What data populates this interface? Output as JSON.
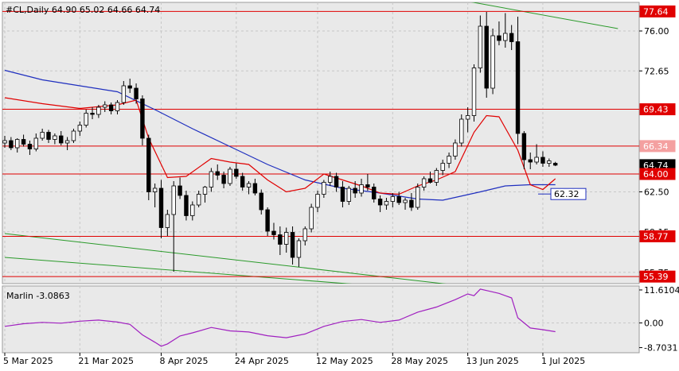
{
  "header": {
    "symbol_line": "#CL,Daily  64.90 65.02 64.66 64.74"
  },
  "colors": {
    "background": "#e9e9e9",
    "grid": "#c8c8c8",
    "support_resistance": "#e00000",
    "bollinger": "#e00000",
    "moving_average": "#1f2fbf",
    "channel": "#2a9a2a",
    "oscillator": "#a020c0",
    "candle_bull": "#ffffff",
    "candle_bear": "#000000"
  },
  "chart_data": [
    {
      "type": "candlestick",
      "title": "#CL,Daily",
      "ohlc_last": {
        "open": 64.9,
        "high": 65.02,
        "low": 64.66,
        "close": 64.74
      },
      "ylim": [
        54.8,
        78.4
      ],
      "y_ticks": [
        "76.00",
        "72.65",
        "62.50",
        "59.15",
        "55.75"
      ],
      "x_ticks": [
        "5 Mar 2025",
        "21 Mar 2025",
        "8 Apr 2025",
        "24 Apr 2025",
        "12 May 2025",
        "28 May 2025",
        "13 Jun 2025",
        "1 Jul 2025"
      ],
      "x_tick_index": [
        0,
        12,
        25,
        37,
        50,
        62,
        74,
        86
      ],
      "price_levels": [
        {
          "value": 77.64,
          "label": "77.64",
          "style": "red-box"
        },
        {
          "value": 69.43,
          "label": "69.43",
          "style": "red-box"
        },
        {
          "value": 66.34,
          "label": "66.34",
          "style": "light-red-box"
        },
        {
          "value": 64.74,
          "label": "64.74",
          "style": "black-box"
        },
        {
          "value": 64.0,
          "label": "64.00",
          "style": "red-box"
        },
        {
          "value": 62.32,
          "label": "62.32",
          "style": "blue-box"
        },
        {
          "value": 58.77,
          "label": "58.77",
          "style": "red-box"
        },
        {
          "value": 55.39,
          "label": "55.39",
          "style": "red-box"
        }
      ],
      "horizontal_lines": [
        77.64,
        69.43,
        66.34,
        64.0,
        58.77,
        55.39
      ],
      "candles": [
        [
          66.6,
          67.2,
          66.2,
          66.8
        ],
        [
          66.8,
          67.1,
          66.0,
          66.2
        ],
        [
          66.2,
          67.0,
          65.8,
          66.9
        ],
        [
          66.9,
          67.3,
          66.3,
          66.5
        ],
        [
          66.5,
          66.8,
          65.6,
          66.1
        ],
        [
          66.1,
          67.4,
          65.9,
          67.0
        ],
        [
          67.0,
          67.8,
          66.8,
          67.5
        ],
        [
          67.5,
          67.7,
          66.6,
          66.9
        ],
        [
          66.9,
          67.4,
          66.5,
          67.2
        ],
        [
          67.2,
          67.6,
          66.4,
          66.6
        ],
        [
          66.6,
          67.1,
          66.0,
          66.8
        ],
        [
          66.8,
          67.8,
          66.6,
          67.6
        ],
        [
          67.6,
          68.4,
          67.2,
          68.1
        ],
        [
          68.1,
          69.4,
          67.9,
          69.1
        ],
        [
          69.1,
          69.6,
          68.6,
          69.0
        ],
        [
          69.0,
          69.8,
          68.7,
          69.6
        ],
        [
          69.6,
          70.1,
          69.2,
          69.8
        ],
        [
          69.8,
          70.0,
          69.0,
          69.3
        ],
        [
          69.3,
          70.2,
          69.0,
          70.0
        ],
        [
          70.0,
          71.8,
          69.8,
          71.4
        ],
        [
          71.4,
          72.0,
          70.8,
          71.2
        ],
        [
          71.2,
          71.6,
          69.9,
          70.3
        ],
        [
          70.3,
          70.6,
          66.4,
          67.0
        ],
        [
          67.0,
          67.3,
          61.8,
          62.5
        ],
        [
          62.5,
          63.2,
          61.2,
          62.8
        ],
        [
          62.8,
          63.5,
          58.6,
          59.5
        ],
        [
          59.5,
          61.0,
          58.8,
          60.6
        ],
        [
          60.6,
          63.4,
          55.8,
          63.0
        ],
        [
          63.0,
          63.7,
          61.9,
          62.2
        ],
        [
          62.2,
          62.6,
          60.1,
          60.5
        ],
        [
          60.5,
          61.7,
          60.1,
          61.4
        ],
        [
          61.4,
          62.6,
          61.2,
          62.3
        ],
        [
          62.3,
          63.0,
          61.6,
          62.9
        ],
        [
          62.9,
          64.5,
          62.5,
          64.2
        ],
        [
          64.2,
          64.8,
          63.5,
          63.9
        ],
        [
          63.9,
          64.2,
          62.8,
          63.2
        ],
        [
          63.2,
          64.6,
          63.0,
          64.4
        ],
        [
          64.4,
          64.9,
          63.6,
          63.8
        ],
        [
          63.8,
          64.1,
          62.6,
          62.9
        ],
        [
          62.9,
          63.4,
          62.3,
          63.2
        ],
        [
          63.2,
          63.6,
          62.2,
          62.4
        ],
        [
          62.4,
          62.7,
          60.6,
          61.0
        ],
        [
          61.0,
          61.2,
          58.8,
          59.2
        ],
        [
          59.2,
          59.9,
          58.5,
          58.9
        ],
        [
          58.9,
          59.6,
          57.2,
          58.1
        ],
        [
          58.1,
          59.5,
          57.4,
          59.1
        ],
        [
          59.1,
          59.6,
          56.4,
          57.0
        ],
        [
          57.0,
          58.6,
          56.2,
          58.4
        ],
        [
          58.4,
          59.6,
          58.0,
          59.4
        ],
        [
          59.4,
          61.5,
          59.1,
          61.2
        ],
        [
          61.2,
          62.6,
          60.8,
          62.3
        ],
        [
          62.3,
          63.5,
          62.0,
          63.3
        ],
        [
          63.3,
          64.2,
          63.0,
          63.8
        ],
        [
          63.8,
          64.1,
          62.5,
          62.9
        ],
        [
          62.9,
          63.4,
          61.2,
          61.7
        ],
        [
          61.7,
          63.0,
          61.4,
          62.8
        ],
        [
          62.8,
          63.4,
          62.0,
          62.4
        ],
        [
          62.4,
          63.6,
          62.1,
          63.1
        ],
        [
          63.1,
          64.0,
          62.6,
          62.9
        ],
        [
          62.9,
          63.2,
          61.6,
          61.9
        ],
        [
          61.9,
          62.2,
          60.8,
          61.4
        ],
        [
          61.4,
          62.0,
          61.0,
          61.7
        ],
        [
          61.7,
          62.4,
          61.2,
          62.1
        ],
        [
          62.1,
          62.5,
          61.4,
          61.6
        ],
        [
          61.6,
          62.0,
          61.0,
          61.8
        ],
        [
          61.8,
          62.4,
          60.9,
          61.2
        ],
        [
          61.2,
          63.2,
          61.0,
          62.9
        ],
        [
          62.9,
          63.8,
          62.6,
          63.6
        ],
        [
          63.6,
          64.2,
          63.2,
          63.3
        ],
        [
          63.3,
          64.5,
          63.0,
          64.3
        ],
        [
          64.3,
          65.2,
          63.9,
          64.9
        ],
        [
          64.9,
          65.8,
          64.5,
          65.5
        ],
        [
          65.5,
          66.9,
          65.2,
          66.6
        ],
        [
          66.6,
          69.0,
          66.3,
          68.6
        ],
        [
          68.6,
          69.6,
          67.5,
          68.9
        ],
        [
          68.9,
          73.2,
          68.4,
          72.9
        ],
        [
          72.9,
          77.3,
          72.5,
          76.4
        ],
        [
          76.4,
          77.6,
          70.4,
          71.2
        ],
        [
          71.2,
          76.2,
          70.7,
          75.6
        ],
        [
          75.6,
          76.8,
          74.8,
          75.2
        ],
        [
          75.2,
          77.5,
          74.6,
          75.8
        ],
        [
          75.8,
          76.5,
          74.4,
          75.1
        ],
        [
          75.1,
          77.2,
          66.5,
          67.4
        ],
        [
          67.4,
          67.6,
          64.4,
          65.2
        ],
        [
          65.2,
          65.8,
          64.4,
          65.0
        ],
        [
          65.0,
          66.5,
          64.8,
          65.4
        ],
        [
          65.4,
          65.9,
          64.6,
          64.9
        ],
        [
          64.9,
          65.3,
          64.6,
          65.1
        ],
        [
          64.9,
          65.02,
          64.66,
          64.74
        ]
      ],
      "moving_average": {
        "name": "",
        "x": [
          0,
          6,
          12,
          18,
          24,
          30,
          36,
          42,
          48,
          54,
          60,
          66,
          70,
          76,
          80,
          84,
          88
        ],
        "y": [
          72.7,
          71.9,
          71.4,
          70.9,
          69.4,
          67.8,
          66.3,
          64.8,
          63.5,
          62.8,
          62.4,
          61.9,
          61.8,
          62.5,
          63.0,
          63.1,
          63.1
        ]
      },
      "bollinger_mid": {
        "name": "",
        "x": [
          0,
          6,
          12,
          18,
          21,
          23,
          26,
          29,
          33,
          36,
          39,
          42,
          45,
          48,
          51,
          54,
          57,
          60,
          63,
          66,
          69,
          72,
          75,
          77,
          79,
          82,
          84,
          86,
          88
        ],
        "y": [
          70.4,
          69.9,
          69.5,
          69.8,
          70.2,
          67.0,
          63.7,
          63.8,
          65.3,
          65.0,
          64.8,
          63.5,
          62.5,
          62.8,
          64.0,
          63.5,
          63.0,
          62.4,
          62.3,
          63.0,
          63.5,
          64.2,
          67.5,
          68.9,
          68.8,
          66.0,
          63.1,
          62.7,
          63.6
        ]
      },
      "channel_lines": [
        {
          "x": [
            0,
            90
          ],
          "y": [
            59.0,
            53.6
          ]
        },
        {
          "x": [
            0,
            77
          ],
          "y": [
            57.0,
            53.9
          ]
        },
        {
          "x": [
            56,
            98
          ],
          "y": [
            80.2,
            76.2
          ]
        }
      ]
    },
    {
      "type": "line",
      "title": "Marlin -3.0863",
      "y_ticks": [
        "11.6104",
        "0.00",
        "-8.7031"
      ],
      "ylim": [
        -10.5,
        13.0
      ],
      "series": [
        {
          "name": "Marlin",
          "x": [
            0,
            3,
            6,
            9,
            12,
            15,
            18,
            20,
            22,
            24,
            25,
            26,
            28,
            30,
            33,
            36,
            39,
            42,
            45,
            48,
            51,
            54,
            57,
            60,
            63,
            66,
            69,
            72,
            74,
            75,
            76,
            77,
            79,
            81,
            82,
            84,
            86,
            88
          ],
          "y": [
            -1.2,
            -0.3,
            0.2,
            -0.1,
            0.6,
            1.0,
            0.3,
            -0.5,
            -4.2,
            -6.8,
            -8.2,
            -7.4,
            -4.6,
            -3.5,
            -1.6,
            -2.8,
            -3.2,
            -4.5,
            -5.2,
            -3.9,
            -1.2,
            0.5,
            1.2,
            0.2,
            1.0,
            3.8,
            5.6,
            8.2,
            10.2,
            9.6,
            11.9,
            11.4,
            10.4,
            8.8,
            1.8,
            -1.8,
            -2.4,
            -3.09
          ]
        }
      ]
    }
  ]
}
